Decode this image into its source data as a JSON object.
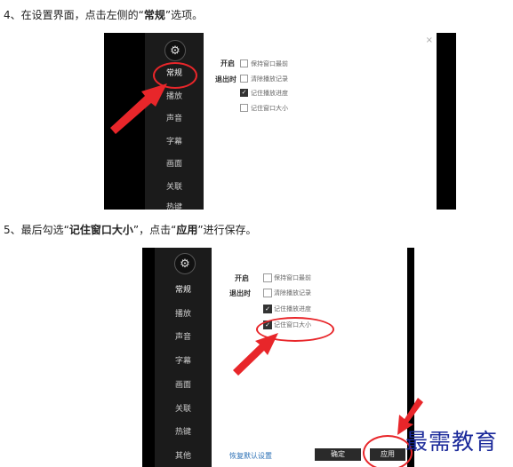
{
  "step4": {
    "prefix": "4、在设置界面，点击左侧的“",
    "bold": "常规",
    "suffix": "”选项。"
  },
  "step5": {
    "prefix": "5、最后勾选“",
    "bold1": "记住窗口大小",
    "mid": "”，点击“",
    "bold2": "应用",
    "suffix": "”进行保存。"
  },
  "screenshot1": {
    "close": "×",
    "nav": [
      "常规",
      "播放",
      "声音",
      "字幕",
      "画面",
      "关联",
      "热键"
    ],
    "labels": {
      "open": "开启",
      "exit": "退出时"
    },
    "options": [
      "保持窗口最前",
      "清除播放记录",
      "记住播放进度",
      "记住窗口大小"
    ],
    "checked": [
      false,
      false,
      true,
      false
    ]
  },
  "screenshot2": {
    "nav": [
      "常规",
      "播放",
      "声音",
      "字幕",
      "画面",
      "关联",
      "热键",
      "其他"
    ],
    "labels": {
      "open": "开启",
      "exit": "退出时"
    },
    "options": [
      "保持窗口最前",
      "清除播放记录",
      "记住播放进度",
      "记住窗口大小"
    ],
    "checked": [
      false,
      false,
      true,
      true
    ],
    "reset": "恢复默认设置",
    "ok": "确定",
    "apply": "应用"
  },
  "icons": {
    "gear": "gear-icon",
    "checkmark": "check-icon"
  },
  "colors": {
    "highlight": "#e8262a",
    "sidebar": "#1b1b1b",
    "link": "#2a6fb5",
    "watermark": "#1b2a9a"
  },
  "watermark": "最需教育"
}
